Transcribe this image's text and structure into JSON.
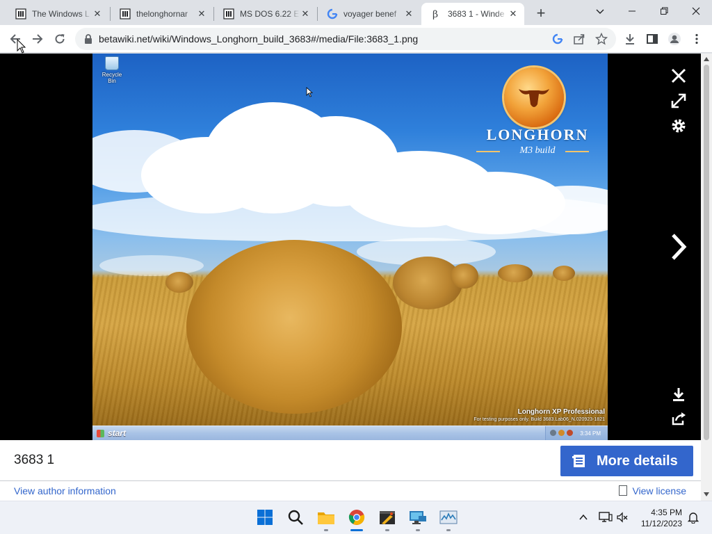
{
  "browser": {
    "tabs": [
      {
        "title": "The Windows L",
        "icon": "wiki-icon",
        "active": false
      },
      {
        "title": "thelonghornar",
        "icon": "wiki-icon",
        "active": false
      },
      {
        "title": "MS DOS 6.22 E",
        "icon": "wiki-icon",
        "active": false
      },
      {
        "title": "voyager benef",
        "icon": "google-icon",
        "active": false
      },
      {
        "title": "3683 1 - Winde",
        "icon": "betawiki-icon",
        "active": true
      }
    ],
    "url": "betawiki.net/wiki/Windows_Longhorn_build_3683#/media/File:3683_1.png"
  },
  "screenshot": {
    "desktop_icon_label": "Recycle Bin",
    "brand": "LONGHORN",
    "brand_sub": "M3 build",
    "edition": "Longhorn XP Professional",
    "edition_sub": "For testing purposes only. Build 3683.Lab06_N.020923-1821",
    "start_label": "start",
    "tray_clock": "3:34 PM"
  },
  "viewer": {
    "file_title": "3683 1",
    "more_details_label": "More details",
    "author_link": "View author information",
    "license_link": "View license"
  },
  "taskbar": {
    "time": "4:35 PM",
    "date": "11/12/2023"
  },
  "colors": {
    "accent": "#3366cc",
    "viewer_bg": "#000000"
  }
}
